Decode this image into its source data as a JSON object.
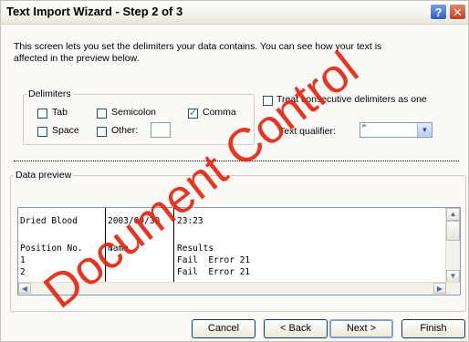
{
  "window": {
    "title": "Text Import Wizard - Step 2 of 3",
    "help_icon": "help-icon",
    "close_icon": "close-icon"
  },
  "description": "This screen lets you set the delimiters your data contains.  You can see how your text is affected in the preview below.",
  "delimiters": {
    "legend": "Delimiters",
    "options": [
      {
        "label": "Tab",
        "checked": false
      },
      {
        "label": "Semicolon",
        "checked": false
      },
      {
        "label": "Comma",
        "checked": true
      },
      {
        "label": "Space",
        "checked": false
      },
      {
        "label": "Other:",
        "checked": false
      }
    ],
    "other_value": ""
  },
  "consecutive": {
    "label": "Treat consecutive delimiters as one",
    "checked": false
  },
  "qualifier": {
    "label": "Text qualifier:",
    "value": "\""
  },
  "preview": {
    "legend": "Data preview",
    "rows": [
      [
        "Dried Blood",
        "2003/09/30",
        "23:23"
      ],
      [
        "",
        "",
        ""
      ],
      [
        "Position No.",
        "Name",
        "Results"
      ],
      [
        "1",
        "",
        "Fail  Error 21"
      ],
      [
        "2",
        "",
        "Fail  Error 21"
      ]
    ]
  },
  "buttons": {
    "cancel": "Cancel",
    "back": "< Back",
    "next": "Next >",
    "finish": "Finish"
  },
  "watermark": "Document Control"
}
